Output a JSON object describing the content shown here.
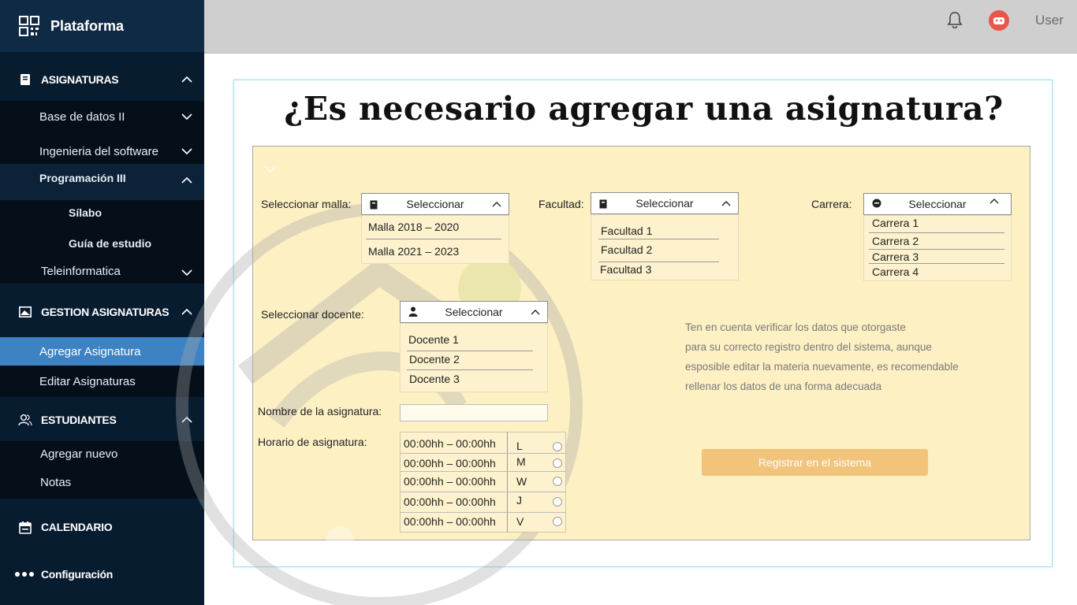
{
  "brand": {
    "name": "Plataforma"
  },
  "topbar": {
    "user": "User"
  },
  "sidebar": {
    "asignaturas": {
      "label": "ASIGNATURAS",
      "items": [
        "Base de datos II",
        "Ingenieria del software",
        "Programación III"
      ],
      "programacion_sub": [
        "Sílabo",
        "Guía de estudio"
      ],
      "teleinformatica": "Teleinformatica"
    },
    "gestion": {
      "label": "GESTION ASIGNATURAS",
      "items": [
        "Agregar Asignatura",
        "Editar Asignaturas"
      ]
    },
    "estudiantes": {
      "label": "ESTUDIANTES",
      "items": [
        "Agregar nuevo",
        "Notas"
      ]
    },
    "calendario": "CALENDARIO",
    "configuracion": "Configuración"
  },
  "main": {
    "title": "¿Es necesario agregar una asignatura?",
    "malla": {
      "label": "Seleccionar malla:",
      "placeholder": "Seleccionar",
      "options": [
        "Malla 2018 – 2020",
        "Malla 2021 – 2023"
      ]
    },
    "facultad": {
      "label": "Facultad:",
      "placeholder": "Seleccionar",
      "options": [
        "Facultad 1",
        "Facultad 2",
        "Facultad 3"
      ]
    },
    "carrera": {
      "label": "Carrera:",
      "placeholder": "Seleccionar",
      "options": [
        "Carrera 1",
        "Carrera 2",
        "Carrera 3",
        "Carrera 4"
      ]
    },
    "docente": {
      "label": "Seleccionar docente:",
      "placeholder": "Seleccionar",
      "options": [
        "Docente 1",
        "Docente 2",
        "Docente 3"
      ]
    },
    "nombre_label": "Nombre de la asignatura:",
    "horario": {
      "label": "Horario de asignatura:",
      "times": [
        "00:00hh – 00:00hh",
        "00:00hh – 00:00hh",
        "00:00hh – 00:00hh",
        "00:00hh – 00:00hh",
        "00:00hh – 00:00hh"
      ],
      "days": [
        "L",
        "M",
        "W",
        "J",
        "V"
      ]
    },
    "tip_lines": [
      "Ten en cuenta verificar los datos  que otorgaste",
      "para su correcto registro dentro del sistema, aunque",
      "esposible editar la materia nuevamente, es recomendable",
      "rellenar los datos de una forma adecuada"
    ],
    "register_button": "Registrar en el sistema"
  },
  "colors": {
    "sidebar": "#081c30",
    "active": "#3d83c4",
    "panel": "#fdf0c3",
    "button": "#f2c37a",
    "avatar": "#e8554a"
  }
}
